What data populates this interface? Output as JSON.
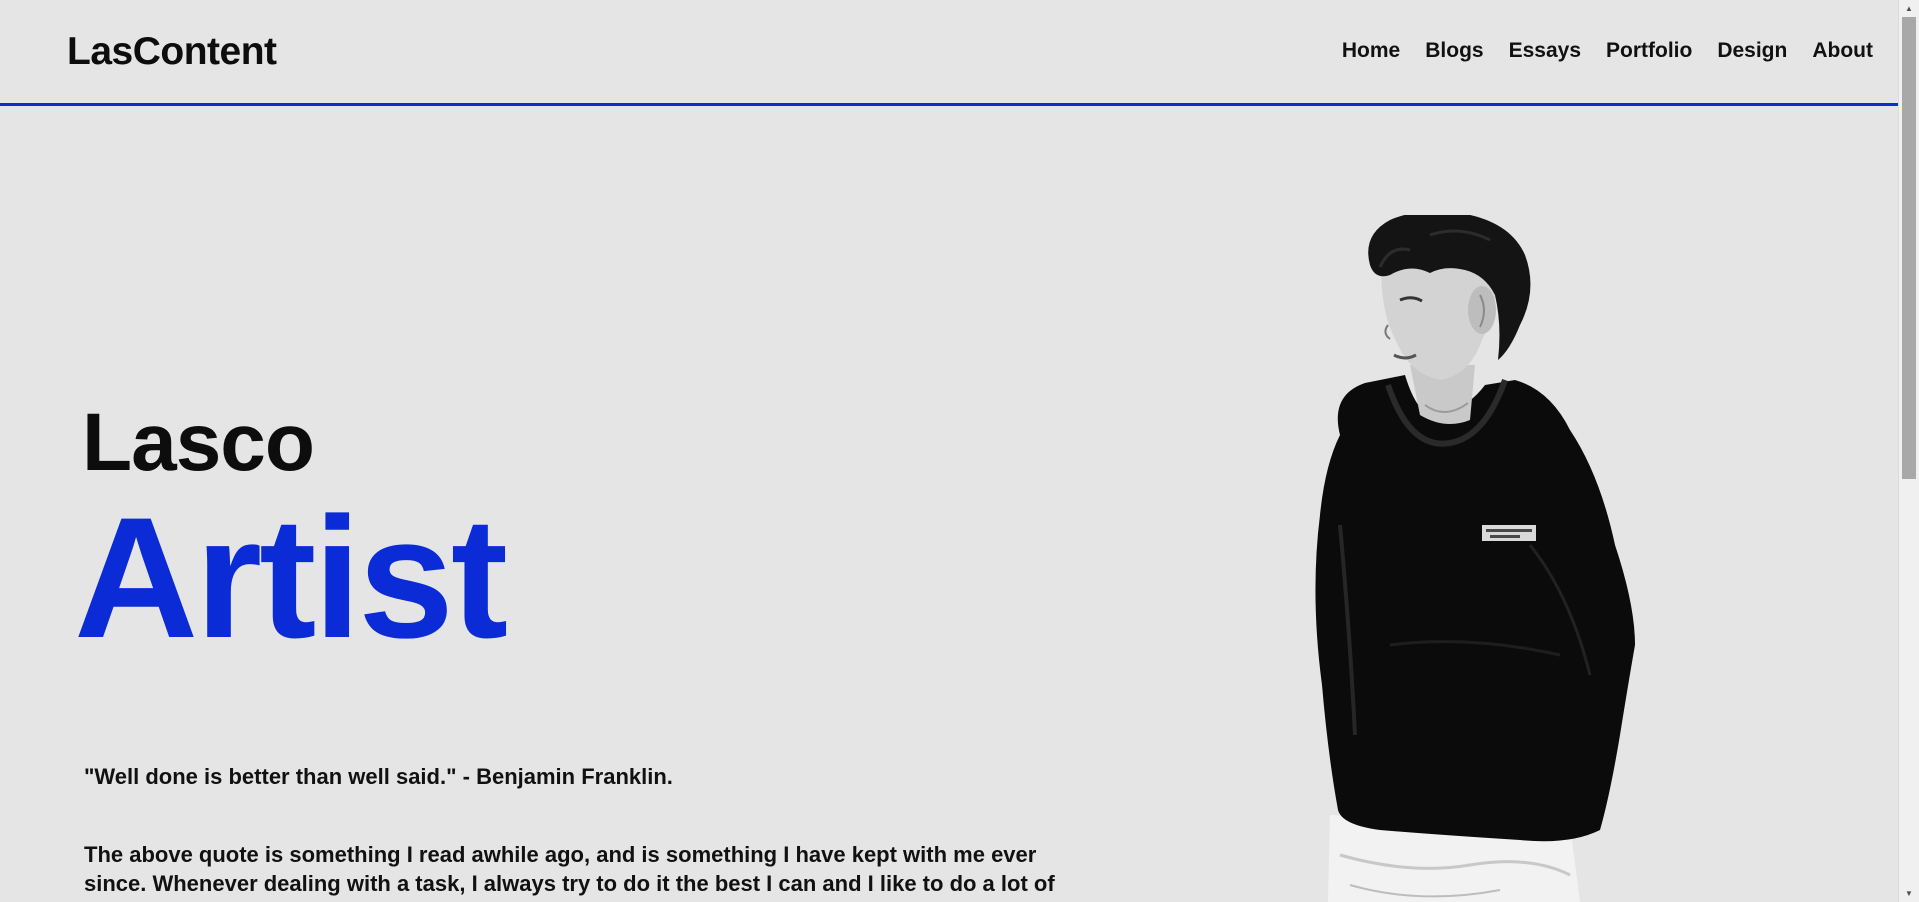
{
  "header": {
    "logo": "LasContent",
    "nav": [
      "Home",
      "Blogs",
      "Essays",
      "Portfolio",
      "Design",
      "About"
    ]
  },
  "hero": {
    "name": "Lasco",
    "role": "Artist",
    "quote": "\"Well done is better than well said.\" - Benjamin Franklin.",
    "bio": "The above quote is something I read awhile ago, and is something I have kept with me ever since. Whenever dealing with a task, I always try to do it the best I can and I like to do a lot of"
  },
  "colors": {
    "accent": "#0a2bd6",
    "background": "#e5e5e5",
    "text": "#111111"
  },
  "icons": {
    "scroll_up": "triangle-up-icon",
    "scroll_down": "triangle-down-icon"
  }
}
